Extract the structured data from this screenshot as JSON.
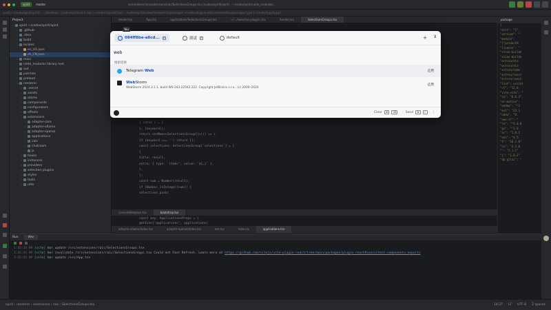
{
  "titlebar": {
    "project": "spirit",
    "branch": "master",
    "filepath": "src/renderer/src/extensions/raic/SelectionsGroups.tsx [/codes/spirit/spirit] - ~/codes/spirit/node_modules/…"
  },
  "pathbar": {
    "text": "spirit [~/codes/spirit/spirit] – ~/Desktop/.../codes/spirit/spirit     raic [~/codes/raycast/raic]     ~/codes/spirit/codes/mellow/dist/packages     ~/codes/plugins-ext/codes/mellow/packages     type [~/codes/typp/typp]"
  },
  "project": {
    "title": "Project",
    "tree": [
      {
        "label": "spirit ~/codes/spirit/spirit",
        "indent": 0,
        "open": true
      },
      {
        "label": ".github",
        "indent": 1
      },
      {
        "label": ".idea",
        "indent": 1
      },
      {
        "label": "build",
        "indent": 1
      },
      {
        "label": "locales",
        "indent": 1,
        "open": true
      },
      {
        "label": "en_US.json",
        "indent": 2,
        "file": true
      },
      {
        "label": "zh_CN.json",
        "indent": 2,
        "file": true
      },
      {
        "label": "main",
        "indent": 1
      },
      {
        "label": "node_modules  library root",
        "indent": 1
      },
      {
        "label": "out",
        "indent": 1
      },
      {
        "label": "patches",
        "indent": 1
      },
      {
        "label": "preload",
        "indent": 1
      },
      {
        "label": "renderer",
        "indent": 1,
        "open": true
      },
      {
        "label": ".vercel",
        "indent": 2
      },
      {
        "label": "assets",
        "indent": 2
      },
      {
        "label": "atoms",
        "indent": 2
      },
      {
        "label": "components",
        "indent": 2
      },
      {
        "label": "configurators",
        "indent": 2
      },
      {
        "label": "effects",
        "indent": 2
      },
      {
        "label": "extensions",
        "indent": 2,
        "open": true
      },
      {
        "label": "adapter-core",
        "indent": 3
      },
      {
        "label": "adapter-ollama",
        "indent": 3
      },
      {
        "label": "adapter-openai",
        "indent": 3
      },
      {
        "label": "applications",
        "indent": 3
      },
      {
        "label": "calc",
        "indent": 3
      },
      {
        "label": "chatroom",
        "indent": 3
      },
      {
        "label": "js",
        "indent": 3
      },
      {
        "label": "hooks",
        "indent": 2
      },
      {
        "label": "instances",
        "indent": 2
      },
      {
        "label": "providers",
        "indent": 2
      },
      {
        "label": "selection-plugins",
        "indent": 2
      },
      {
        "label": "styles",
        "indent": 2
      },
      {
        "label": "tools",
        "indent": 2
      },
      {
        "label": "utils",
        "indent": 2
      }
    ]
  },
  "editor": {
    "tabs": [
      "render.tsx",
      "App.tsx",
      "applications/SelectionsGroups.tsx",
      "~/.../selection-plugins.tsx",
      "Render.tsx",
      "SelectionsGroups.tsx"
    ],
    "lines": [
      "} catch { … }",
      "}, [keyword]);",
      "return useMemo<SelectionsGroup[]>(() => {",
      "  if (keyword === '') return [];",
      "  const selections: SelectionsGroup['selections'] = [",
      "    {",
      "      title: result,",
      "      extra: { type: 'items', value: `${…}` },",
      "    },",
      "  ];",
      "  const num = Number(result);",
      "  if (Number.isInteger(num)) {",
      "    selections.push("
    ],
    "tabs2": [
      "consoleWebpack.tsx",
      "bootstrap.tsx"
    ],
    "tabs3": [
      "adapter-ollama/index.tsx",
      "adapter-openai/index.tsx",
      "bot.tsx",
      "index.ts",
      "applications.tsx"
    ],
    "extra_lines": [
      "const key: ApplicationsProps = {",
      "  getIcon('applications', applications)"
    ]
  },
  "rightpane": {
    "tab": "package",
    "lines": [
      "{",
      "  \"dist\": \"2\",",
      "  \"version\": \"",
      "  \"module\":",
      "  \"{\"productN",
      "  \"license\": \"",
      "  \"ctron-builde",
      "  \"ction-builde",
      "  \"ectron/ele",
      "  \"ectron/ele",
      "  \"ectron/node",
      "  \"ectron/react",
      "  \"ectron/react",
      "  \"lint\": eslint",
      "  \"ct\": \"12.0.",
      "  \"vite-vite\": \"",
      "  \"cx\": \"0.0.3\",",
      "  \"er-motion\":",
      "  \"oodeq\": \"^2",
      "  \"ext\": \"23.1",
      "  \"ndow\": \"0.",
      "  \"own-it\": \"",
      "  \"le\": \"^4.0.0",
      "  \"gs\": \"^3.0",
      "  \"ar\": \"1.0.1",
      "  \"ons\": \"4.5.",
      "  \"t\": \"18.1.0\"",
      "  \"ni\": \"4.2.0",
      "  \"\": \"2.1.1\"",
      "  \"i\": \"1.0.2\"",
      "  \"dp.gitui\": \""
    ]
  },
  "run": {
    "label": "Run",
    "tab": "dev",
    "logs": [
      {
        "ts": "1:45:33 AM",
        "tag": "[vite]",
        "text": "hmr update /src/extensions/raic/SelectionsGroups.tsx"
      },
      {
        "ts": "1:45:34 AM",
        "tag": "[vite]",
        "text": "hmr invalidate /src/extensions/raic/SelectionsGroups.tsx Could not Fast Refresh. Learn more at ",
        "link": "https://github.com/vitejs/vite-plugin-react/tree/main/packages/plugin-react#consistent-components-exports"
      },
      {
        "ts": "1:45:35 AM",
        "tag": "[vite]",
        "text": "hmr update /src/App.tsx"
      }
    ]
  },
  "statusbar": {
    "breadcrumb": "spirit  ›  renderer  ›  extensions  ›  raic  ›  SelectionsGroups.tsx",
    "position": "14:27",
    "line_sep": "LF",
    "encoding": "UTF-8",
    "indent": "2 spaces"
  },
  "launcher": {
    "tabs": [
      {
        "label": "084ff8be-a8cd...",
        "active": true
      },
      {
        "label": "测试",
        "active": false
      },
      {
        "label": "default",
        "active": false
      }
    ],
    "add_label": "+",
    "filter_label": "⊻",
    "query": "web",
    "tooltip": "You",
    "section": "搜索结果",
    "results": [
      {
        "name_prefix": "Telegram ",
        "name_match": "Web",
        "sub": "",
        "action": "应用",
        "color": "#2aa3e0"
      },
      {
        "name_prefix": "",
        "name_match": "Web",
        "name_suffix": "Storm",
        "sub": "WebStorm 2024.3.1.1, build WS-243.22562.222. Copyright JetBrains s.r.o., (c) 2000–2024",
        "action": "应用",
        "color": "#1d1d1f"
      }
    ],
    "footer": {
      "clear_label": "Clear",
      "clear_keys": [
        "⌘",
        "⌫"
      ],
      "send_label": "Send",
      "send_keys": [
        "⌘",
        "↵"
      ],
      "more": "⋮"
    }
  },
  "colors": {
    "accent": "#1b4fc4",
    "ide_bg": "#1e1f22",
    "panel_bg": "#2b2d30"
  }
}
